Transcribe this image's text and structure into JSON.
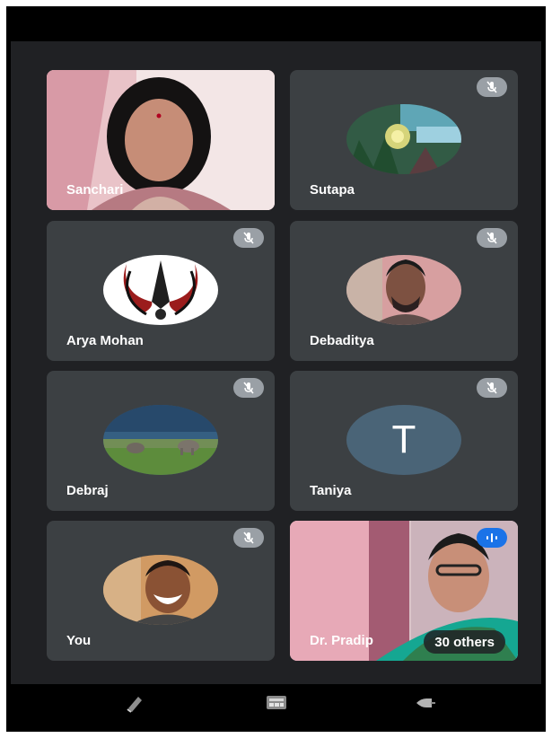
{
  "participants": [
    {
      "name": "Sanchari",
      "muted": false,
      "type": "video"
    },
    {
      "name": "Sutapa",
      "muted": true,
      "type": "avatar"
    },
    {
      "name": "Arya Mohan",
      "muted": true,
      "type": "avatar"
    },
    {
      "name": "Debaditya",
      "muted": true,
      "type": "avatar"
    },
    {
      "name": "Debraj",
      "muted": true,
      "type": "avatar"
    },
    {
      "name": "Taniya",
      "muted": true,
      "type": "letter",
      "initial": "T"
    },
    {
      "name": "You",
      "muted": true,
      "type": "avatar"
    },
    {
      "name": "Dr. Pradip",
      "muted": false,
      "type": "video",
      "others_label": "30 others"
    }
  ],
  "bottom_bar": {
    "icons": [
      "reactions-icon",
      "meeting-tools-icon",
      "more-icon"
    ]
  },
  "colors": {
    "tile_bg": "#3c4043",
    "meet_bg": "#202124",
    "muted_badge": "#9aa0a6",
    "speaking_badge": "#1a73e8"
  }
}
